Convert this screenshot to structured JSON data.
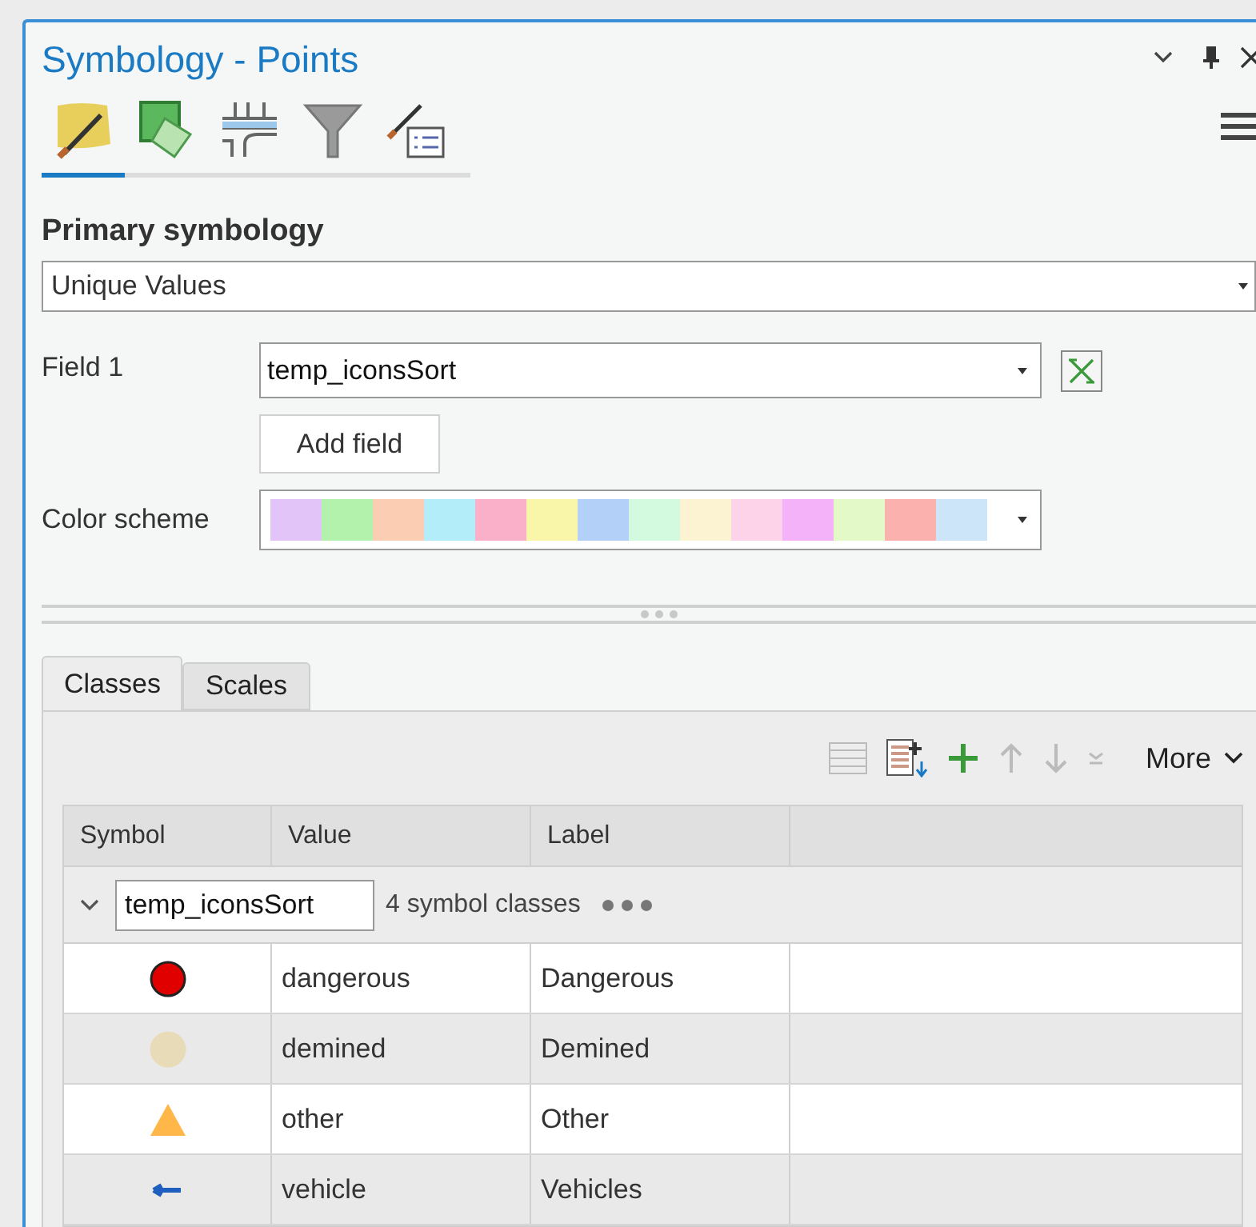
{
  "window": {
    "title": "Symbology - Points"
  },
  "tools": [
    {
      "kind": "primary",
      "selected": true
    },
    {
      "kind": "vary",
      "selected": false
    },
    {
      "kind": "labels",
      "selected": false
    },
    {
      "kind": "filter",
      "selected": false
    },
    {
      "kind": "display",
      "selected": false
    }
  ],
  "primary_symbology": {
    "heading": "Primary symbology",
    "value": "Unique Values"
  },
  "field_1": {
    "label": "Field 1",
    "value": "temp_iconsSort",
    "add_button": "Add field"
  },
  "color_scheme": {
    "label": "Color scheme",
    "swatches": [
      {
        "color": "#e3c4f9"
      },
      {
        "color": "#b3f2ad"
      },
      {
        "color": "#fbcdb2"
      },
      {
        "color": "#b3edfa"
      },
      {
        "color": "#f9b0c8"
      },
      {
        "color": "#f9f6a9"
      },
      {
        "color": "#b3d0f9"
      },
      {
        "color": "#d3f9df"
      },
      {
        "color": "#fcf3d3"
      },
      {
        "color": "#fcd3e8"
      },
      {
        "color": "#f4b3f9"
      },
      {
        "color": "#e3f9c8"
      },
      {
        "color": "#fbb1ad"
      },
      {
        "color": "#cde5f9"
      }
    ]
  },
  "tabs": [
    {
      "label": "Classes",
      "selected": true
    },
    {
      "label": "Scales",
      "selected": false
    }
  ],
  "toolbar": {
    "more": "More"
  },
  "table": {
    "columns": [
      "Symbol",
      "Value",
      "Label"
    ],
    "group": {
      "field": "temp_iconsSort",
      "count": "4 symbol classes"
    },
    "rows": [
      {
        "kind": "circle",
        "color": "#e00000",
        "value": "dangerous",
        "label": "Dangerous"
      },
      {
        "kind": "circle",
        "color": "#e8dcb8",
        "value": "demined",
        "label": "Demined"
      },
      {
        "kind": "triangle",
        "color": "#ffb74a",
        "value": "other",
        "label": "Other"
      },
      {
        "kind": "arrow",
        "color": "#1f5fbf",
        "value": "vehicle",
        "label": "Vehicles"
      }
    ]
  }
}
